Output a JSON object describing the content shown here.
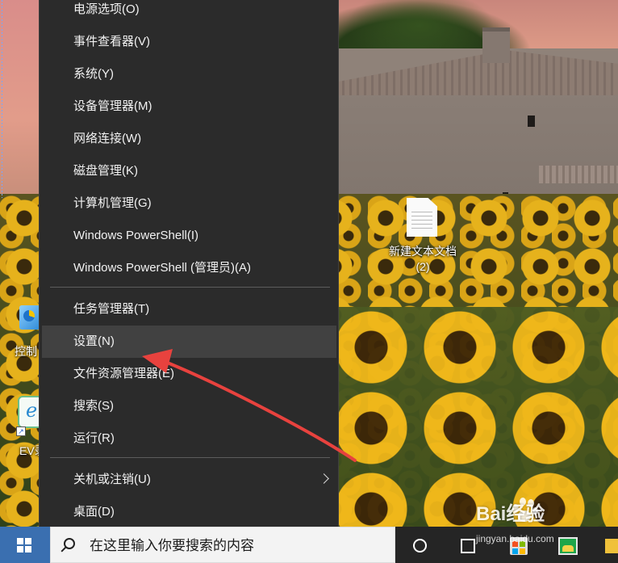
{
  "menu": {
    "items": [
      {
        "label": "电源选项(O)"
      },
      {
        "label": "事件查看器(V)"
      },
      {
        "label": "系统(Y)"
      },
      {
        "label": "设备管理器(M)"
      },
      {
        "label": "网络连接(W)"
      },
      {
        "label": "磁盘管理(K)"
      },
      {
        "label": "计算机管理(G)"
      },
      {
        "label": "Windows PowerShell(I)"
      },
      {
        "label": "Windows PowerShell (管理员)(A)"
      },
      {
        "label": "任务管理器(T)"
      },
      {
        "label": "设置(N)"
      },
      {
        "label": "文件资源管理器(E)"
      },
      {
        "label": "搜索(S)"
      },
      {
        "label": "运行(R)"
      },
      {
        "label": "关机或注销(U)"
      },
      {
        "label": "桌面(D)"
      }
    ],
    "highlighted_item": "设置(N)",
    "submenu_item": "关机或注销(U)"
  },
  "desktop": {
    "icons": [
      {
        "label": "新建文本文档\n(2)",
        "icon": "text-document-icon"
      },
      {
        "label": "控制",
        "icon": "control-panel-icon"
      },
      {
        "label": "EV录",
        "icon": "ev-recorder-icon"
      }
    ]
  },
  "taskbar": {
    "search_placeholder": "在这里输入你要搜索的内容",
    "icons": [
      "windows-start-icon",
      "search-icon",
      "cortana-icon",
      "task-view-icon",
      "store-icon",
      "photos-icon",
      "file-explorer-icon"
    ]
  },
  "annotation": {
    "color": "#e8423e",
    "points_to": "设置(N)"
  },
  "watermark": {
    "brand": "Bai经验",
    "url": "jingyan.baidu.com"
  },
  "colors": {
    "menu_bg": "#2b2b2b",
    "menu_hover": "#414141",
    "menu_text": "#f2f2f2",
    "start_button": "#3a6fb0",
    "search_box": "#f3f3f3"
  }
}
